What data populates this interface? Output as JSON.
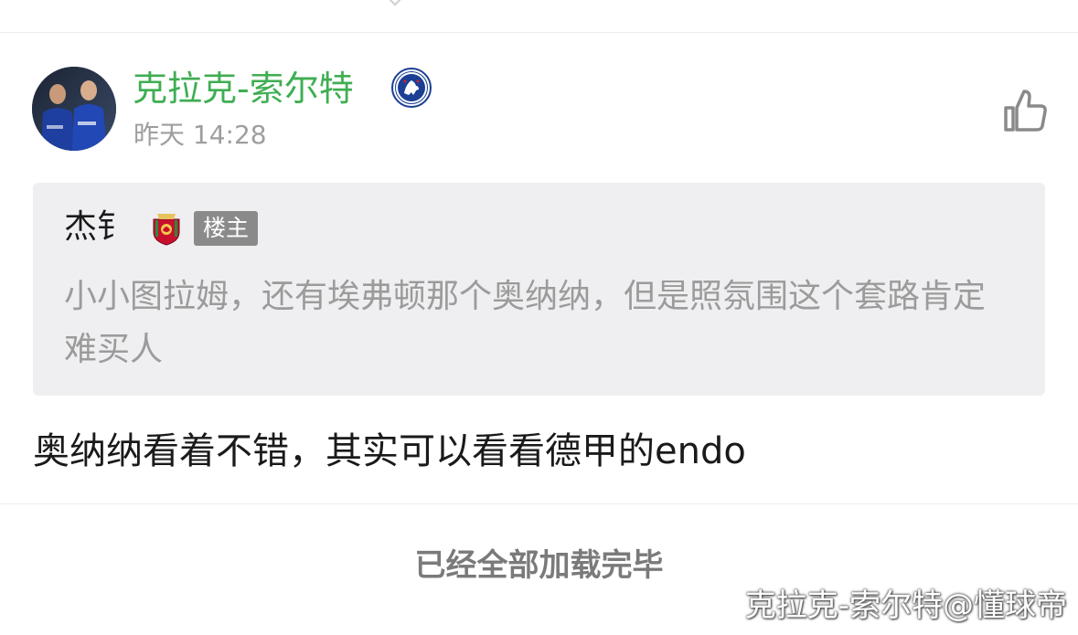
{
  "comment": {
    "author": {
      "name": "克拉克-索尔特",
      "avatar": "player-photo-avatar",
      "badge_icon": "chelsea-crest-icon"
    },
    "time": "昨天 14:28",
    "like_icon": "thumbs-up-icon",
    "quote": {
      "author": "杰钅",
      "badge_icon": "liverpool-crest-icon",
      "tag": "楼主",
      "text": "小小图拉姆，还有埃弗顿那个奥纳纳，但是照氛围这个套路肯定难买人"
    },
    "body": "奥纳纳看着不错，其实可以看看德甲的endo"
  },
  "footer": {
    "status": "已经全部加载完毕"
  },
  "watermark": "克拉克-索尔特@懂球帝",
  "colors": {
    "username_green": "#3fae52",
    "quote_bg": "#efeff1",
    "tag_bg": "#8a8a8a"
  }
}
